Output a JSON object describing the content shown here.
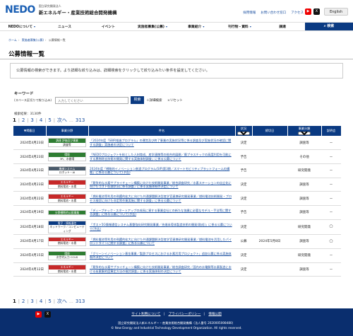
{
  "header": {
    "logo_mark": "NEDO",
    "logo_sub": "国立研究開発法人",
    "logo_main": "新エネルギー・産業技術総合開発機構",
    "links": [
      "採用情報",
      "お問い合わせ窓口",
      "アクセス"
    ],
    "english_label": "English",
    "social": [
      "youtube-icon",
      "x-icon"
    ]
  },
  "nav": {
    "items": [
      "NEDOについて",
      "ニュース",
      "イベント",
      "実施者募集(公募)",
      "事業紹介",
      "刊行物・資料",
      "調達"
    ],
    "search_label": "検索"
  },
  "breadcrumb": [
    "ホーム",
    "実施者募集(公募)",
    "公募情報一覧"
  ],
  "page_title": "公募情報一覧",
  "description": "公募情報の検索ができます。より詳細な絞り込みは、詳細検索をクリックして絞り込みたい条件を設定してください。",
  "keyword": {
    "title": "キーワード",
    "note": "(スペース区切りで絞り込み)",
    "placeholder": "入力してください",
    "search_button": "検索",
    "detail_label": "詳細検索",
    "reset_label": "リセット"
  },
  "count_text": "検索結果：3130件",
  "pager": {
    "current": "1",
    "pages": [
      "2",
      "3",
      "4",
      "5"
    ],
    "next": "次へ",
    "last": "313"
  },
  "table": {
    "headers": {
      "date": "掲載日",
      "category": "事業分野",
      "title": "件名",
      "status": "状況",
      "status_select": "すべて",
      "deadline": "締切日",
      "type": "事業分類",
      "type_select": "すべて",
      "briefing": "説明会"
    },
    "rows": [
      {
        "date": "2024年4月23日",
        "cat_top": "調達 評価及び事業",
        "cat_bot": "調査等",
        "color": "#2e7d32",
        "title": "「2024年度「SBIR推進プログラム」の運営及び終了事業の実施状況等に係る調査及び実施状況の確認に関する調査」実施者の決定について",
        "status": "決定",
        "deadline": "",
        "type": "調査等",
        "briefing": "ー"
      },
      {
        "date": "2024年4月23日",
        "cat_top": "環境",
        "cat_bot": "3R、水循環",
        "color": "#2e7d32",
        "title": "「NEDOプロジェクトを核とした人材育成、産学連携等の総合的展開／廃プラスチックの高度利用を可能にする異物除去技術の開発に関する実施体制調査」に係る公募について",
        "status": "予告",
        "deadline": "",
        "type": "その他",
        "briefing": "ー"
      },
      {
        "date": "2024年4月23日",
        "cat_top": "機械システム",
        "cat_bot": "ロボット・AI",
        "color": "#4a5a6a",
        "title": "2024年度「戦略的イノベーション創造プログラム(SIP)第3期／スマートモビリティプラットフォームの構築」に係る公募について(予告)",
        "status": "予告",
        "deadline": "",
        "type": "研究開発",
        "briefing": "ー"
      },
      {
        "date": "2024年4月23日",
        "cat_top": "エネルギー",
        "cat_bot": "燃料電池・水素",
        "color": "#c62828",
        "title": "「競争的な水素サプライチェーン構築に向けた技術開発事業／総合調査研究／水素ステーションの自立化に向けたコスト低減状況に係る調査」に係る実施体制の決定について",
        "status": "決定",
        "deadline": "",
        "type": "調査等",
        "briefing": "ー"
      },
      {
        "date": "2024年4月22日",
        "cat_top": "エネルギー",
        "cat_bot": "燃料電池・水素",
        "color": "#c62828",
        "title": "「燃料電池等利用の飛躍的拡大に向けた共通課題解決型産学官連携研究開発事業／燃料電池技術開発・プロセス検討に向けた非定常作業実施に関する調査」に係る公募について",
        "status": "決定",
        "deadline": "",
        "type": "調査等",
        "briefing": "ー"
      },
      {
        "date": "2024年4月19日",
        "cat_top": "分野横断的公募事業",
        "cat_bot": "",
        "color": "#2e7d32",
        "title": "「ディープテック・スタートアップの成長に資する事業会社との新たな協業に必要なモデル・手法等に関する調査」に係る公募について(予告)",
        "status": "予告",
        "deadline": "",
        "type": "調査等",
        "briefing": "ー"
      },
      {
        "date": "2024年4月18日",
        "cat_top": "電子・情報通信",
        "cat_bot": "ネットワーク／コンピューティング",
        "color": "#0a3a82",
        "title": "「ポスト5G情報通信システム基盤強化研究開発事業／先端半導体製造技術の開発(助成)」に係る公募について(予告)",
        "status": "決定",
        "deadline": "",
        "type": "研究開発",
        "briefing": "◯"
      },
      {
        "date": "2024年4月17日",
        "cat_top": "エネルギー",
        "cat_bot": "燃料電池・水素",
        "color": "#c62828",
        "title": "「燃料電池等利用の飛躍的拡大に向けた共通課題解決型産学官連携研究開発事業／燃料電池を活用したパイロットラインに関する調査」に係る公募について",
        "status": "公募",
        "deadline": "2024年5月8日",
        "type": "調査等",
        "briefing": "◯"
      },
      {
        "date": "2024年4月15日",
        "cat_top": "環境",
        "cat_bot": "次世代火力 CCUS",
        "color": "#2e7d32",
        "title": "「グリーンイノベーション基金事業／製鉄プロセスにおける水素活用プロジェクト」追加公募に係る実施体制の決定について",
        "status": "決定",
        "deadline": "",
        "type": "研究開発",
        "briefing": "ー"
      },
      {
        "date": "2024年4月12日",
        "cat_top": "エネルギー",
        "cat_bot": "燃料電池・水素",
        "color": "#c62828",
        "title": "「競争的な水素サプライチェーン構築に向けた技術開発事業／総合調査研究／国内の水電解等水素製造における炭素集約度算定方法の検討調査」に係る実施体制の決定について",
        "status": "決定",
        "deadline": "",
        "type": "調査等",
        "briefing": "ー"
      }
    ]
  },
  "footer": {
    "links": [
      "サイト利用について",
      "プライバシーポリシー",
      "情報公開"
    ],
    "org": "国立研究開発法人新エネルギー・産業技術総合開発機構（法人番号 2020005008480）",
    "copy": "© New Energy and Industrial Technology Development Organization. All rights reserved."
  }
}
